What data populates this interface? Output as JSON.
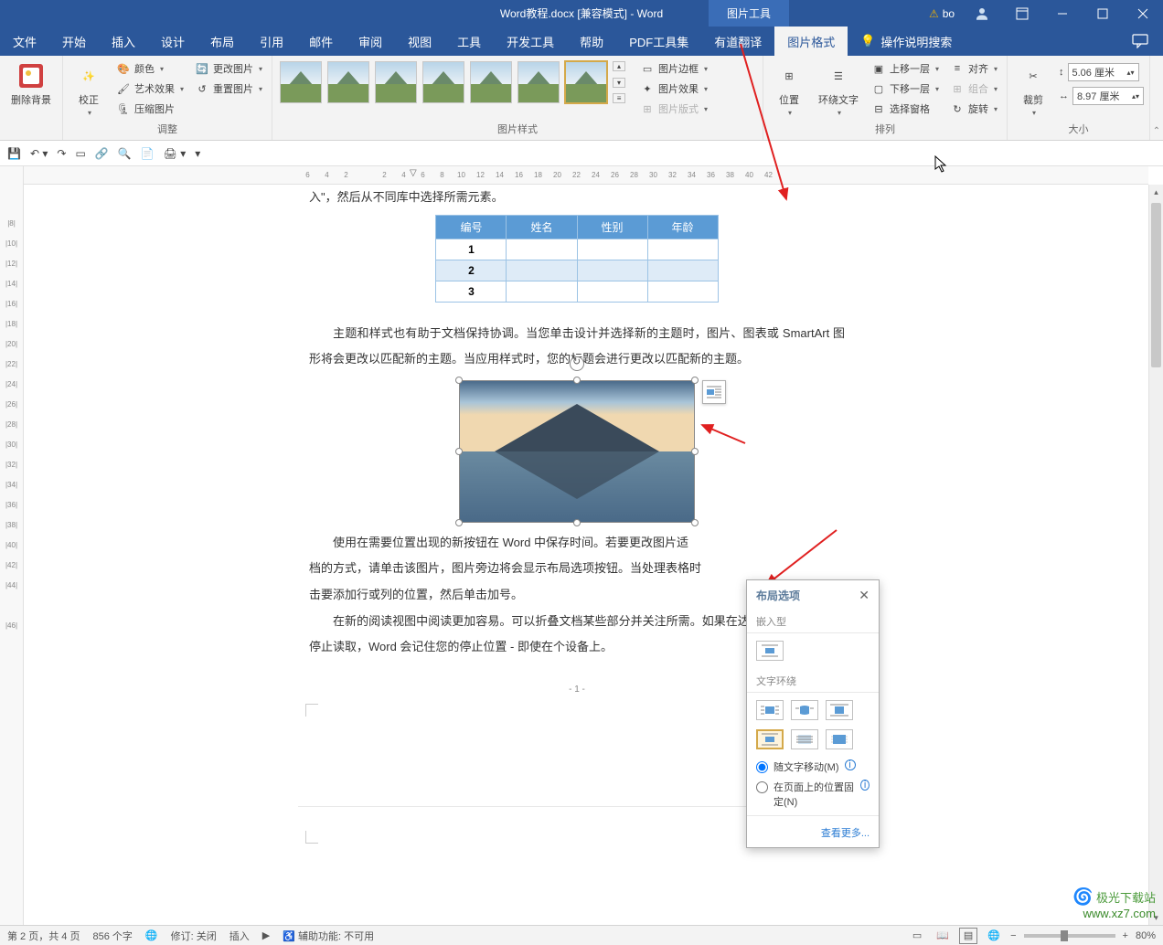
{
  "titlebar": {
    "title": "Word教程.docx [兼容模式] - Word",
    "context_tab": "图片工具",
    "user": "bo",
    "warn_icon": "⚠"
  },
  "tabs": {
    "file": "文件",
    "home": "开始",
    "insert": "插入",
    "design": "设计",
    "layout": "布局",
    "references": "引用",
    "mailings": "邮件",
    "review": "审阅",
    "view": "视图",
    "tools": "工具",
    "developer": "开发工具",
    "help": "帮助",
    "pdf": "PDF工具集",
    "youdao": "有道翻译",
    "picfmt": "图片格式",
    "search": "操作说明搜索"
  },
  "ribbon": {
    "remove_bg": "删除背景",
    "corrections": "校正",
    "color": "颜色",
    "artistic": "艺术效果",
    "compress": "压缩图片",
    "change_pic": "更改图片",
    "reset_pic": "重置图片",
    "adjust_group": "调整",
    "styles_group": "图片样式",
    "pic_border": "图片边框",
    "pic_effects": "图片效果",
    "pic_layout": "图片版式",
    "position": "位置",
    "wrap_text": "环绕文字",
    "bring_fwd": "上移一层",
    "send_back": "下移一层",
    "selection_pane": "选择窗格",
    "align": "对齐",
    "group": "组合",
    "rotate": "旋转",
    "arrange_group": "排列",
    "crop": "裁剪",
    "size_group": "大小",
    "height_val": "5.06 厘米",
    "width_val": "8.97 厘米"
  },
  "doc": {
    "line1_suffix": "入\"，然后从不同库中选择所需元素。",
    "table_headers": [
      "编号",
      "姓名",
      "性别",
      "年龄"
    ],
    "table_rows": [
      "1",
      "2",
      "3"
    ],
    "para2": "主题和样式也有助于文档保持协调。当您单击设计并选择新的主题时，图片、图表或 SmartArt 图形将会更改以匹配新的主题。当应用样式时，您的标题会进行更改以匹配新的主题。",
    "para3a": "使用在需要位置出现的新按钮在 Word 中保存时间。若要更改图片适",
    "para3b": "档的方式，请单击该图片，图片旁边将会显示布局选项按钮。当处理表格时",
    "para3c": "击要添加行或列的位置，然后单击加号。",
    "para4": "在新的阅读视图中阅读更加容易。可以折叠文档某些部分并关注所需。如果在达到结尾处之前需要停止读取，Word 会记住您的停止位置 - 即使在个设备上。",
    "page_num": "- 1 -"
  },
  "layout_popup": {
    "title": "布局选项",
    "inline_section": "嵌入型",
    "wrap_section": "文字环绕",
    "radio_move": "随文字移动(M)",
    "radio_fixed": "在页面上的位置固定(N)",
    "more": "查看更多..."
  },
  "statusbar": {
    "page": "第 2 页，共 4 页",
    "words": "856 个字",
    "revision": "修订: 关闭",
    "insert_mode": "插入",
    "accessibility": "辅助功能: 不可用",
    "zoom": "80%"
  },
  "watermark": {
    "line1": "极光下载站",
    "line2": "www.xz7.com"
  },
  "ruler_nums_h": [
    "6",
    "4",
    "2",
    "",
    "2",
    "4",
    "6",
    "8",
    "10",
    "12",
    "14",
    "16",
    "18",
    "20",
    "22",
    "24",
    "26",
    "28",
    "30",
    "32",
    "34",
    "36",
    "38",
    "40",
    "42"
  ],
  "ruler_nums_v": [
    "",
    "|8|",
    "|10|",
    "|12|",
    "|14|",
    "|16|",
    "|18|",
    "|20|",
    "|22|",
    "|24|",
    "|26|",
    "|28|",
    "|30|",
    "|32|",
    "|34|",
    "|36|",
    "|38|",
    "|40|",
    "|42|",
    "|44|",
    "",
    "|46|"
  ]
}
